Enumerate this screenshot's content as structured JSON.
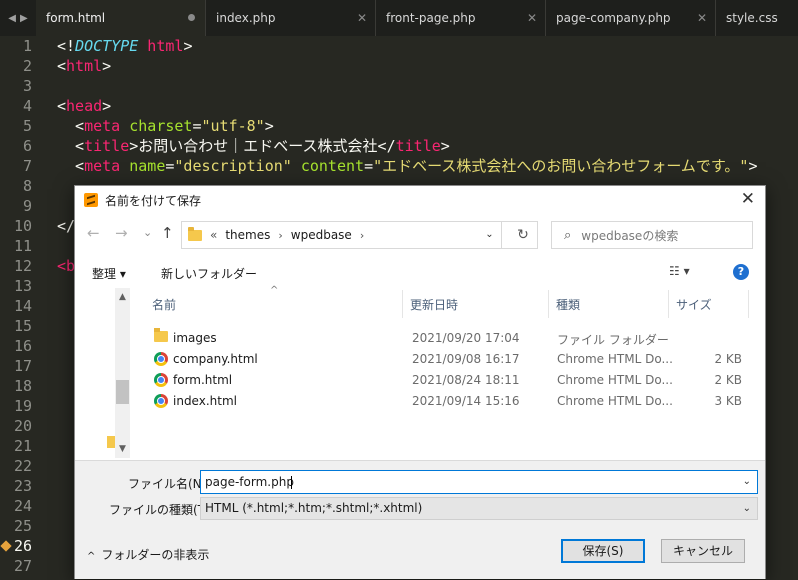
{
  "editor": {
    "tabs": [
      {
        "label": "form.html",
        "active": true,
        "modified": true
      },
      {
        "label": "index.php"
      },
      {
        "label": "front-page.php"
      },
      {
        "label": "page-company.php"
      },
      {
        "label": "style.css"
      }
    ],
    "line_numbers": [
      "1",
      "2",
      "3",
      "4",
      "5",
      "6",
      "7",
      "8",
      "9",
      "10",
      "11",
      "12",
      "13",
      "14",
      "15",
      "16",
      "17",
      "18",
      "19",
      "20",
      "21",
      "22",
      "23",
      "24",
      "25",
      "26",
      "27"
    ],
    "current_line": "26",
    "code": {
      "l1_open": "<!",
      "l1_doctype": "DOCTYPE",
      "l1_html": " html",
      "l1_close": ">",
      "l2": "html",
      "l4": "head",
      "l5_tag": "meta",
      "l5_attr": "charset",
      "l5_val": "\"utf-8\"",
      "l6_tag": "title",
      "l6_text": "お問い合わせ｜エドベース株式会社",
      "l7_tag": "meta",
      "l7_attr1": "name",
      "l7_val1": "\"description\"",
      "l7_attr2": "content",
      "l7_val2": "\"エドベース株式会社へのお問い合わせフォームです。\"",
      "l10": "</",
      "l12": "<b"
    }
  },
  "dialog": {
    "title": "名前を付けて保存",
    "close": "✕",
    "nav": {
      "back": "←",
      "forward": "→",
      "history": "⌄",
      "up": "↑",
      "refresh": "↻"
    },
    "breadcrumb": {
      "overflow": "«",
      "items": [
        "themes",
        "wpedbase"
      ],
      "sep": "›"
    },
    "search_placeholder": "wpedbaseの検索",
    "toolbar": {
      "organize": "整理 ▾",
      "new_folder": "新しいフォルダー",
      "view": "☷ ▾",
      "help": "?"
    },
    "columns": {
      "name": "名前",
      "modified": "更新日時",
      "type": "種類",
      "size": "サイズ"
    },
    "files": [
      {
        "name": "images",
        "modified": "2021/09/20 17:04",
        "type": "ファイル フォルダー",
        "size": "",
        "icon": "folder-icon"
      },
      {
        "name": "company.html",
        "modified": "2021/09/08 16:17",
        "type": "Chrome HTML Do...",
        "size": "2 KB",
        "icon": "chrome-icon"
      },
      {
        "name": "form.html",
        "modified": "2021/08/24 18:11",
        "type": "Chrome HTML Do...",
        "size": "2 KB",
        "icon": "chrome-icon"
      },
      {
        "name": "index.html",
        "modified": "2021/09/14 15:16",
        "type": "Chrome HTML Do...",
        "size": "3 KB",
        "icon": "chrome-icon"
      }
    ],
    "filename_label": "ファイル名(N):",
    "filename_value": "page-form.php",
    "filetype_label": "ファイルの種類(T):",
    "filetype_value": "HTML (*.html;*.htm;*.shtml;*.xhtml)",
    "hide_folders": "フォルダーの非表示",
    "save": "保存(S)",
    "cancel": "キャンセル"
  },
  "colors": {
    "editor_bg": "#272822",
    "accent": "#0078d7"
  }
}
